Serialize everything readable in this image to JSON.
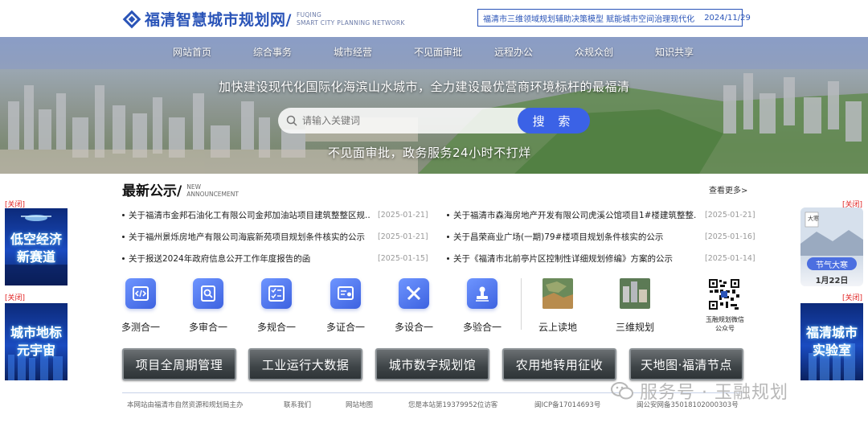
{
  "header": {
    "logo_cn": "福清智慧城市规划网/",
    "logo_en_line1": "FUQING",
    "logo_en_line2": "SMART CITY PLANNING NETWORK",
    "notice_text": "福清市三维领域规划辅助决策模型 赋能城市空间治理现代化",
    "notice_date": "2024/11/29"
  },
  "nav": {
    "items": [
      "网站首页",
      "综合事务",
      "城市经营",
      "不见面审批",
      "远程办公",
      "众规众创",
      "知识共享"
    ]
  },
  "banner": {
    "slogan": "加快建设现代化国际化海滨山水城市，全力建设最优营商环境标杆的最福清",
    "search_placeholder": "请输入关键词",
    "search_button": "搜 索",
    "slogan2": "不见面审批，政务服务24小时不打烊"
  },
  "announcements": {
    "title_cn": "最新公示/",
    "title_en_line1": "NEW",
    "title_en_line2": "ANNOUNCEMENT",
    "more": "查看更多>",
    "left": [
      {
        "text": "关于福清市金邦石油化工有限公司金邦加油站项目建筑整整区规...",
        "date": "[2025-01-21]"
      },
      {
        "text": "关于福州景烁房地产有限公司海宸新苑项目规划条件核实的公示",
        "date": "[2025-01-21]"
      },
      {
        "text": "关于报送2024年政府信息公开工作年度报告的函",
        "date": "[2025-01-15]"
      }
    ],
    "right": [
      {
        "text": "关于福清市森海房地产开发有限公司虎溪公馆项目1#楼建筑整整...",
        "date": "[2025-01-21]"
      },
      {
        "text": "关于昌荣商业广场(一期)79#楼项目规划条件核实的公示",
        "date": "[2025-01-16]"
      },
      {
        "text": "关于《福清市北前亭片区控制性详细规划修编》方案的公示",
        "date": "[2025-01-14]"
      }
    ]
  },
  "services": {
    "items": [
      {
        "label": "多测合一",
        "icon": "code-icon"
      },
      {
        "label": "多审合一",
        "icon": "search-doc-icon"
      },
      {
        "label": "多规合一",
        "icon": "checklist-icon"
      },
      {
        "label": "多证合一",
        "icon": "certificate-icon"
      },
      {
        "label": "多设合一",
        "icon": "tools-icon"
      },
      {
        "label": "多验合一",
        "icon": "stamp-icon"
      }
    ],
    "extra": [
      {
        "label": "云上读地"
      },
      {
        "label": "三维规划"
      }
    ],
    "qr_label_line1": "玉融规划微信",
    "qr_label_line2": "公众号"
  },
  "bottom_buttons": [
    "项目全周期管理",
    "工业运行大数据",
    "城市数字规划馆",
    "农用地转用征收",
    "天地图·福清节点"
  ],
  "footer": {
    "sponsor": "本网站由福清市自然资源和规划局主办",
    "contact": "联系我们",
    "sitemap": "网站地图",
    "visitors": "您是本站第19379952位访客",
    "icp": "闽ICP备17014693号",
    "police": "闽公安网备35018102000303号"
  },
  "watermark": "服务号 · 玉融规划",
  "side_ads": {
    "close_label": "[关闭]",
    "left_top": [
      "低空经济",
      "新赛道"
    ],
    "left_bottom": [
      "城市地标",
      "元宇宙"
    ],
    "right_top_tag": "节气大寒",
    "right_top_date": "1月22日",
    "right_top_badge": "大寒",
    "right_bottom": [
      "福清城市",
      "实验室"
    ]
  },
  "colors": {
    "brand_blue": "#2a54b8",
    "search_button": "#3b62e6",
    "close_red": "#e02020"
  }
}
